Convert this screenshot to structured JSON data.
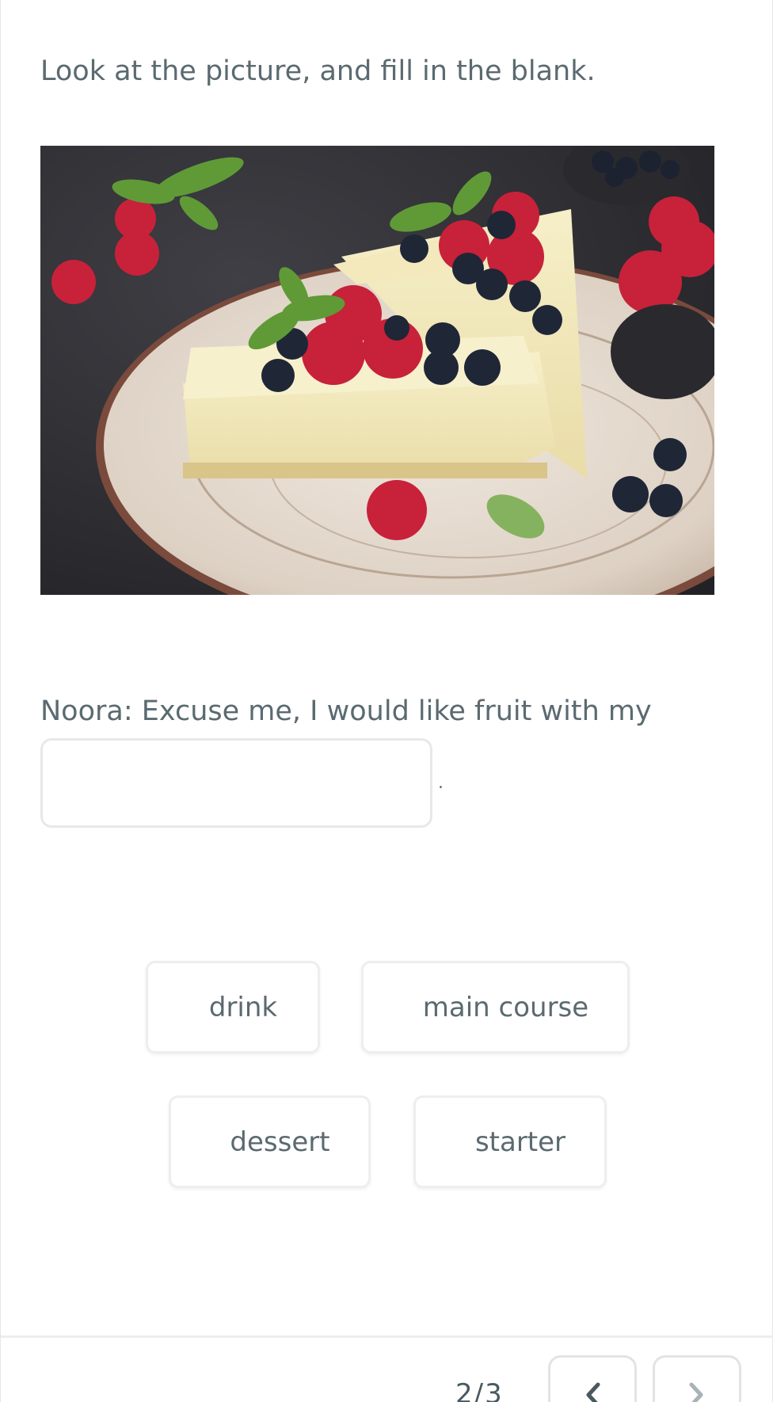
{
  "instruction": "Look at the picture, and fill in the blank.",
  "image": {
    "description_icon": "cheesecake-photo"
  },
  "question": {
    "sentence": "Noora: Excuse me, I would like fruit with my",
    "blank_value": "",
    "end_punctuation": "."
  },
  "options": [
    {
      "label": "drink"
    },
    {
      "label": "main course"
    },
    {
      "label": "dessert"
    },
    {
      "label": "starter"
    }
  ],
  "footer": {
    "counter": "2/3",
    "prev_icon": "chevron-left-icon",
    "next_icon": "chevron-right-icon"
  },
  "colors": {
    "text": "#5b6a70",
    "border": "#e8e8e8",
    "prev_arrow": "#4a5960",
    "next_arrow": "#a9b3b7"
  }
}
